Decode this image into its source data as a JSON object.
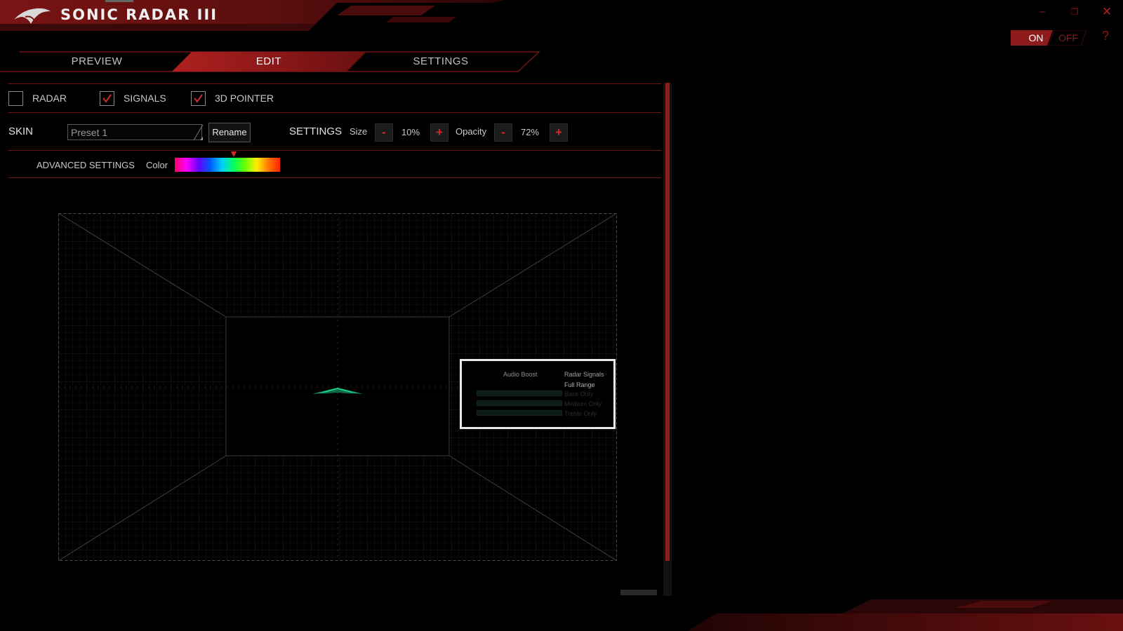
{
  "app": {
    "title": "SONIC RADAR III",
    "window_controls": {
      "minimize": "–",
      "restore": "❐",
      "close": "✕"
    },
    "help": "?"
  },
  "power": {
    "on_label": "ON",
    "off_label": "OFF",
    "state": "ON",
    "accent": "#a01c1c"
  },
  "tabs": [
    {
      "label": "PREVIEW",
      "active": false
    },
    {
      "label": "EDIT",
      "active": true
    },
    {
      "label": "SETTINGS",
      "active": false
    }
  ],
  "edit": {
    "checks": [
      {
        "label": "RADAR",
        "checked": false
      },
      {
        "label": "SIGNALS",
        "checked": true
      },
      {
        "label": "3D POINTER",
        "checked": true
      }
    ],
    "skin": {
      "label": "SKIN",
      "value": "Preset 1",
      "rename_label": "Rename"
    },
    "settings": {
      "label": "SETTINGS",
      "size": {
        "label": "Size",
        "value": "10%",
        "minus": "-",
        "plus": "+"
      },
      "opacity": {
        "label": "Opacity",
        "value": "72%",
        "minus": "-",
        "plus": "+"
      }
    },
    "advanced": {
      "label": "ADVANCED SETTINGS",
      "color_label": "Color",
      "color_position": 0.56
    }
  },
  "preview_panel": {
    "audio_boost": "Audio Boost",
    "radar_signals": "Radar Signals",
    "full_range": "Full Range",
    "bass_only": "Bass Only",
    "medium_only": "Medium Only",
    "treble_only": "Treble Only"
  },
  "colors": {
    "accent_red": "#a01c1c",
    "pointer_green": "#1ecc8a",
    "grid": "#1c1c1c"
  }
}
